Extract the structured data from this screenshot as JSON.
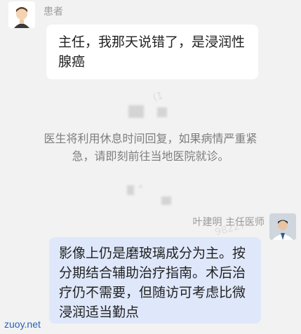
{
  "patient": {
    "name": "患者",
    "message": "主任，我那天说错了，是浸润性腺癌"
  },
  "system_notice": {
    "line1": "医生将利用休息时间回复，如果病情严重紧",
    "line2": "急，请即刻前往当地医院就诊。"
  },
  "doctor": {
    "name_title": "叶建明 主任医师",
    "message": "影像上仍是磨玻璃成分为主。按分期结合辅助治疗指南。术后治疗仍不需要，但随访可考虑比微浸润适当勤点"
  },
  "watermark": {
    "text": "zuoy.net"
  }
}
